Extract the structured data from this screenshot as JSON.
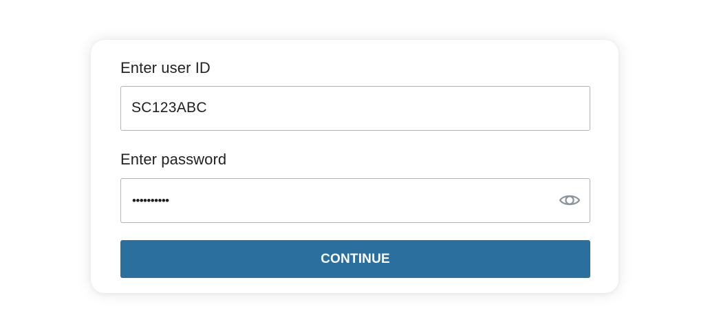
{
  "login_form": {
    "user_id": {
      "label": "Enter user ID",
      "value": "SC123ABC"
    },
    "password": {
      "label": "Enter password",
      "masked_value": "••••••••••",
      "toggle_icon": "eye-icon"
    },
    "continue_label": "CONTINUE"
  },
  "colors": {
    "button_background": "#2a6f9e",
    "button_text": "#ffffff",
    "input_border": "#a9b4bf",
    "label_text": "#222222",
    "eye_icon": "#8a949d"
  }
}
